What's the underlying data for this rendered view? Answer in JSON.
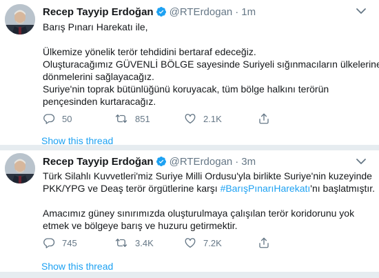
{
  "colors": {
    "accent": "#1da1f2",
    "text": "#14171a",
    "muted": "#657786",
    "divider": "#e6ecf0"
  },
  "tweets": [
    {
      "author_name": "Recep Tayyip Erdoğan",
      "handle": "@RTErdogan",
      "separator": "·",
      "time": "1m",
      "lines": [
        "Barış Pınarı Harekatı ile,",
        "",
        "Ülkemize yönelik terör tehdidini bertaraf edeceğiz.",
        "Oluşturacağımız GÜVENLİ BÖLGE sayesinde Suriyeli sığınmacıların ülkelerine",
        "dönmelerini sağlayacağız.",
        "Suriye'nin toprak bütünlüğünü koruyacak, tüm bölge halkını terörün",
        "pençesinden kurtaracağız."
      ],
      "reply_count": "50",
      "retweet_count": "851",
      "like_count": "2.1K",
      "thread_link": "Show this thread",
      "icons": [
        "avatar",
        "verified-badge-icon",
        "chevron-down-icon",
        "reply-icon",
        "retweet-icon",
        "heart-icon",
        "share-icon"
      ]
    },
    {
      "author_name": "Recep Tayyip Erdoğan",
      "handle": "@RTErdogan",
      "separator": "·",
      "time": "3m",
      "line_1": "Türk Silahlı Kuvvetleri'miz Suriye Milli Ordusu'yla birlikte Suriye'nin kuzeyinde",
      "line_2_before": "PKK/YPG ve Deaş terör örgütlerine karşı ",
      "hashtag": "#BarışPınarıHarekatı",
      "line_2_after": "'nı başlatmıştır.",
      "line_3": "Amacımız güney sınırımızda oluşturulmaya çalışılan terör koridorunu yok",
      "line_4": "etmek ve bölgeye barış ve huzuru getirmektir.",
      "reply_count": "745",
      "retweet_count": "3.4K",
      "like_count": "7.2K",
      "thread_link": "Show this thread",
      "icons": [
        "avatar",
        "verified-badge-icon",
        "chevron-down-icon",
        "reply-icon",
        "retweet-icon",
        "heart-icon",
        "share-icon"
      ]
    }
  ]
}
